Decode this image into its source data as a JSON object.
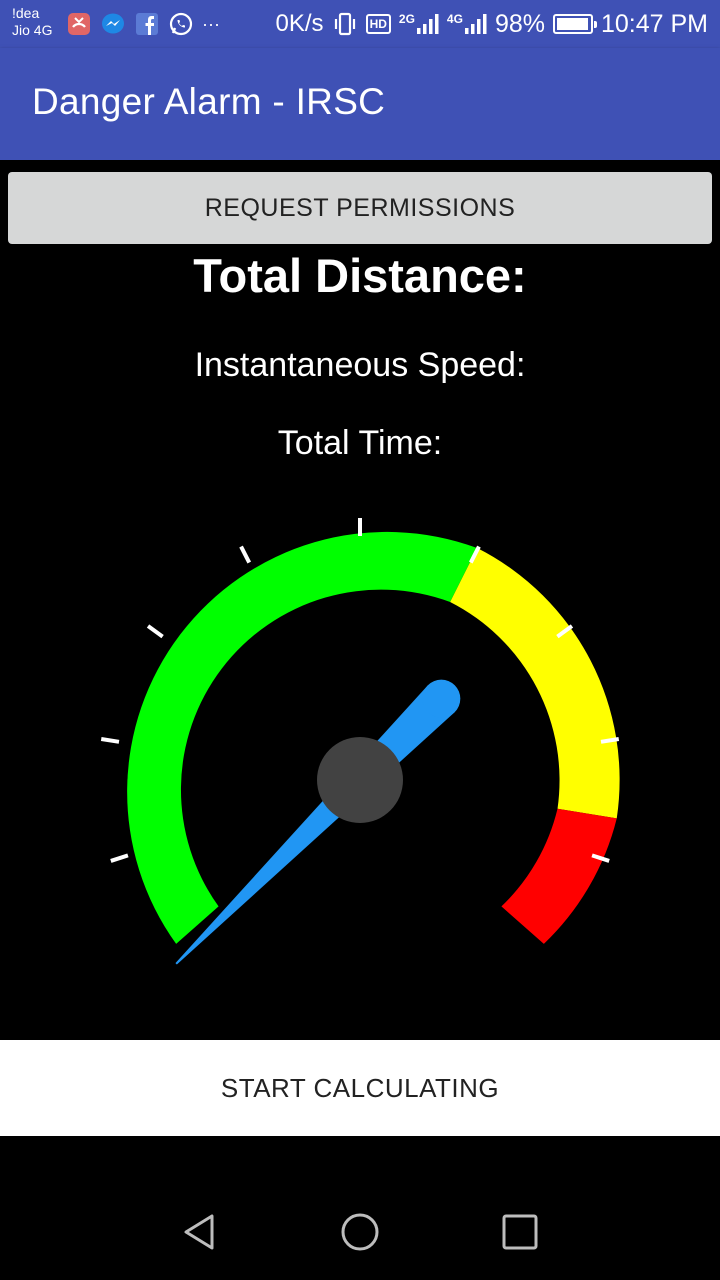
{
  "status_bar": {
    "carrier_1": "!dea",
    "carrier_2": "Jio 4G",
    "notif_more": "···",
    "net_speed": "0K/s",
    "hd_badge": "HD",
    "signal_1_label": "2G",
    "signal_2_label": "4G",
    "battery_percent": "98%",
    "battery_level": 0.98,
    "time": "10:47 PM"
  },
  "app_bar": {
    "title": "Danger Alarm - IRSC"
  },
  "request_permissions": {
    "label": "REQUEST PERMISSIONS"
  },
  "stats": {
    "total_distance_label": "Total Distance:",
    "instantaneous_speed_label": "Instantaneous Speed:",
    "total_time_label": "Total Time:"
  },
  "gauge": {
    "colors": {
      "green": "#00ff00",
      "yellow": "#ffff00",
      "red": "#ff0000",
      "needle": "#2196f3",
      "hub": "#424242"
    },
    "needle_position": 0.0
  },
  "start_calculating": {
    "label": "START CALCULATING"
  },
  "colors": {
    "app_bar": "#3f51b5",
    "background": "#000000"
  },
  "nav_bar": {
    "icons": [
      "back-icon",
      "home-icon",
      "recents-icon"
    ]
  }
}
